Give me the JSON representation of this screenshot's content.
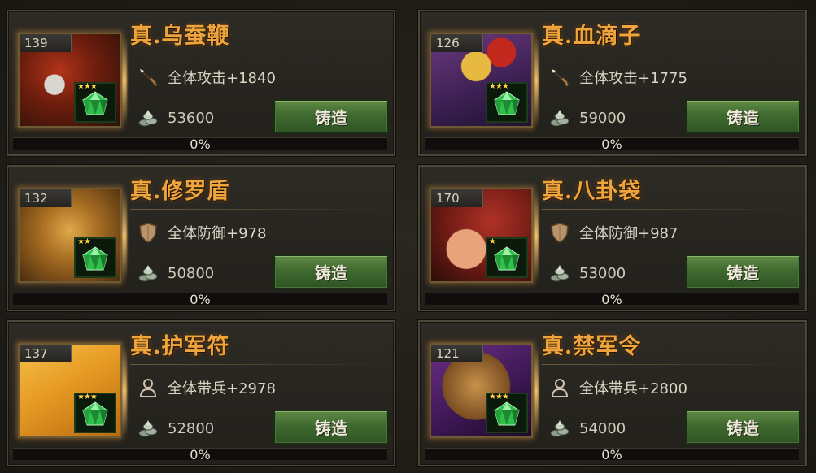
{
  "forge_button_label": "铸造",
  "items": [
    {
      "level": "139",
      "name": "真.乌蚕鞭",
      "stat_icon": "sword-icon",
      "stat": "全体攻击+1840",
      "cost": "53600",
      "stars": 3,
      "progress": "0%",
      "art": "whip"
    },
    {
      "level": "126",
      "name": "真.血滴子",
      "stat_icon": "sword-icon",
      "stat": "全体攻击+1775",
      "cost": "59000",
      "stars": 3,
      "progress": "0%",
      "art": "blood"
    },
    {
      "level": "132",
      "name": "真.修罗盾",
      "stat_icon": "shield-icon",
      "stat": "全体防御+978",
      "cost": "50800",
      "stars": 2,
      "progress": "0%",
      "art": "shield"
    },
    {
      "level": "170",
      "name": "真.八卦袋",
      "stat_icon": "shield-icon",
      "stat": "全体防御+987",
      "cost": "53000",
      "stars": 1,
      "progress": "0%",
      "art": "bag"
    },
    {
      "level": "137",
      "name": "真.护军符",
      "stat_icon": "person-icon",
      "stat": "全体带兵+2978",
      "cost": "52800",
      "stars": 3,
      "progress": "0%",
      "art": "scroll"
    },
    {
      "level": "121",
      "name": "真.禁军令",
      "stat_icon": "person-icon",
      "stat": "全体带兵+2800",
      "cost": "54000",
      "stars": 3,
      "progress": "0%",
      "art": "token"
    }
  ],
  "colors": {
    "title": "#f0a53c",
    "button": "#3f6a2f",
    "gem": "#2fbf4a"
  }
}
